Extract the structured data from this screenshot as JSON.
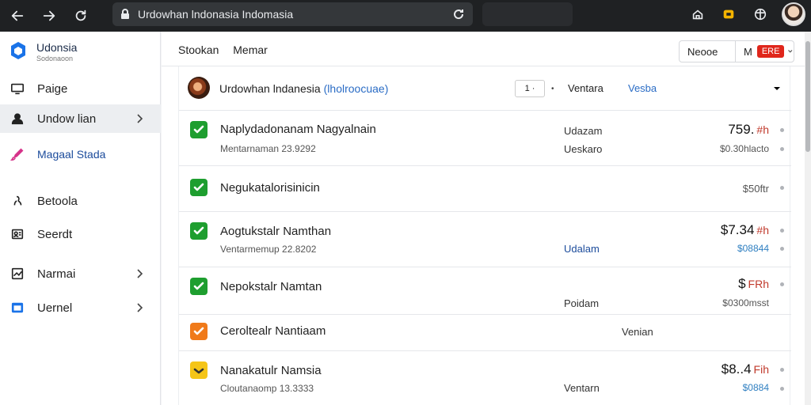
{
  "browser": {
    "url": "Urdowhan lndonasia Indomasia"
  },
  "sidebar": {
    "brand_name": "Udonsia",
    "brand_sub": "Sodonaoon",
    "items": [
      {
        "label": "Paige",
        "icon": "monitor-icon",
        "has_chevron": false
      },
      {
        "label": "Undow lian",
        "icon": "user-icon",
        "has_chevron": true,
        "active": true
      },
      {
        "label": "Magaal Stada",
        "icon": "brush-icon",
        "has_chevron": false
      },
      {
        "label": "Betoola",
        "icon": "person-outline-icon",
        "has_chevron": false
      },
      {
        "label": "Seerdt",
        "icon": "id-card-icon",
        "has_chevron": false
      },
      {
        "label": "Narmai",
        "icon": "chart-icon",
        "has_chevron": true
      },
      {
        "label": "Uernel",
        "icon": "window-icon",
        "has_chevron": true
      }
    ]
  },
  "topbar": {
    "crumb_1": "Stookan",
    "crumb_2": "Memar",
    "btn_1": "Neooe",
    "btn_2": "M",
    "btn_2_badge": "ERE"
  },
  "panel_head": {
    "title": "Urdowhan lndanesia",
    "title_accent": "(lholroocuae)",
    "stepper": "1 ·",
    "label_1": "Ventara",
    "label_2": "Vesba"
  },
  "rows": [
    {
      "title": "Naplydadonanam Nagyalnain",
      "sub": "Mentarnaman 23.9292",
      "col": "Udazam",
      "col2": "Ueskaro",
      "amount": "759.",
      "currency": "#h",
      "amount_sub": "$0.30hlacto",
      "check": "#1e9e2f"
    },
    {
      "title": "Negukatalorisinicin",
      "sub": "",
      "col": "",
      "col2": "",
      "amount": "",
      "currency": "",
      "amount_sub": "$50ftr",
      "check": "#1e9e2f"
    },
    {
      "title": "Aogtukstalr Namthan",
      "sub": "Ventarmemup 22.8202",
      "col": "Udalam",
      "col2": "",
      "amount": "$7.34",
      "currency": "#h",
      "amount_sub": "$08844",
      "check": "#1e9e2f"
    },
    {
      "title": "Nepokstalr Namtan",
      "sub": "",
      "col": "",
      "col2": "Poidam",
      "amount": "$",
      "currency": "FRh",
      "amount_sub": "$0300msst",
      "check": "#1e9e2f"
    },
    {
      "title": "Ceroltealr Nantiaam",
      "sub": "",
      "col": "Venian",
      "col2": "",
      "amount": "",
      "currency": "",
      "amount_sub": "",
      "check": "#f07a1a"
    },
    {
      "title": "Nanakatulr Namsia",
      "sub": "Cloutanaomp 13.3333",
      "col": "",
      "col2": "Ventarn",
      "amount": "$8..4",
      "currency": "Fih",
      "amount_sub": "$0884",
      "check": "#f5c518"
    }
  ],
  "colors": {
    "accent_blue": "#2a6cc5",
    "check_green": "#1e9e2f",
    "check_orange": "#f07a1a",
    "check_yellow": "#f5c518",
    "badge_red": "#e0261b"
  }
}
